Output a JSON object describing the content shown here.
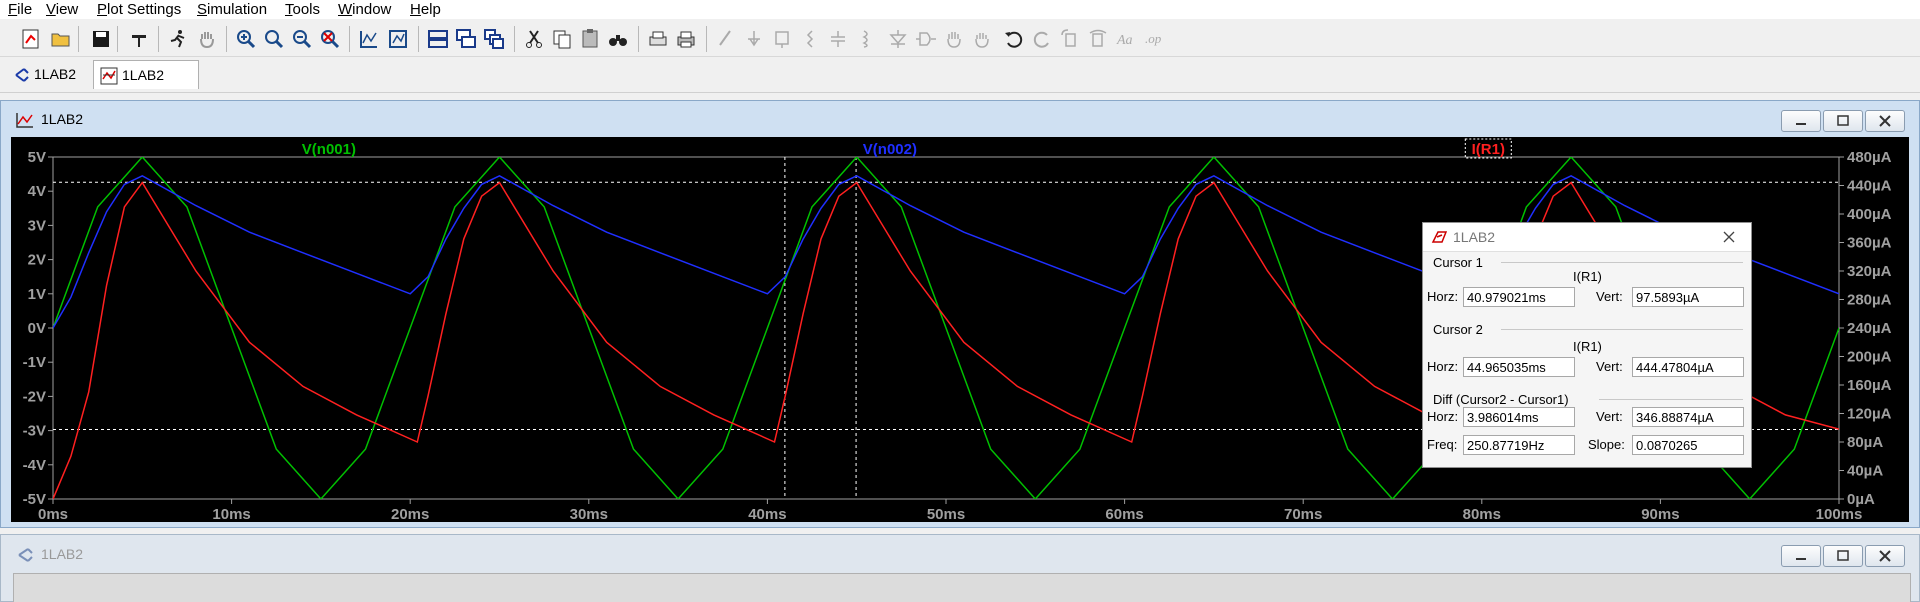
{
  "menu": [
    {
      "label": "File",
      "key": "F"
    },
    {
      "label": "View",
      "key": "V"
    },
    {
      "label": "Plot Settings",
      "key": "P"
    },
    {
      "label": "Simulation",
      "key": "S"
    },
    {
      "label": "Tools",
      "key": "T"
    },
    {
      "label": "Window",
      "key": "W"
    },
    {
      "label": "Help",
      "key": "H"
    }
  ],
  "tabs": [
    {
      "label": "1LAB2",
      "icon": "schematic-icon"
    },
    {
      "label": "1LAB2",
      "icon": "waveform-icon"
    }
  ],
  "plot_window": {
    "title": "1LAB2",
    "icon": "waveform-icon"
  },
  "schematic_window": {
    "title": "1LAB2",
    "icon": "schematic-icon"
  },
  "cursor_window": {
    "title": "1LAB2",
    "cursor1": {
      "heading": "Cursor 1",
      "trace": "I(R1)",
      "horz_label": "Horz:",
      "horz": "40.979021ms",
      "vert_label": "Vert:",
      "vert": "97.5893µA"
    },
    "cursor2": {
      "heading": "Cursor 2",
      "trace": "I(R1)",
      "horz_label": "Horz:",
      "horz": "44.965035ms",
      "vert_label": "Vert:",
      "vert": "444.47804µA"
    },
    "diff": {
      "heading": "Diff (Cursor2 - Cursor1)",
      "horz_label": "Horz:",
      "horz": "3.986014ms",
      "vert_label": "Vert:",
      "vert": "346.88874µA",
      "freq_label": "Freq:",
      "freq": "250.87719Hz",
      "slope_label": "Slope:",
      "slope": "0.0870265"
    }
  },
  "chart_data": {
    "type": "line",
    "title": "",
    "xlabel": "",
    "ylabel": "",
    "xlim": [
      0,
      100
    ],
    "x_ticks": [
      "0ms",
      "10ms",
      "20ms",
      "30ms",
      "40ms",
      "50ms",
      "60ms",
      "70ms",
      "80ms",
      "90ms",
      "100ms"
    ],
    "ylim_left": [
      -5,
      5
    ],
    "y_ticks_left": [
      "5V",
      "4V",
      "3V",
      "2V",
      "1V",
      "0V",
      "-1V",
      "-2V",
      "-3V",
      "-4V",
      "-5V"
    ],
    "ylim_right": [
      0,
      480
    ],
    "y_ticks_right": [
      "480µA",
      "440µA",
      "400µA",
      "360µA",
      "320µA",
      "280µA",
      "240µA",
      "200µA",
      "160µA",
      "120µA",
      "80µA",
      "40µA",
      "0µA"
    ],
    "grid": false,
    "cursors": {
      "x": [
        40.979,
        44.965
      ],
      "y_right": [
        97.5893,
        444.478
      ]
    },
    "series": [
      {
        "name": "V(n001)",
        "color": "#00c000",
        "axis": "left",
        "x": [
          0,
          2.5,
          5,
          7.5,
          10,
          12.5,
          15,
          17.5,
          20,
          22.5,
          25,
          27.5,
          30,
          32.5,
          35,
          37.5,
          40,
          42.5,
          45,
          47.5,
          50,
          52.5,
          55,
          57.5,
          60,
          62.5,
          65,
          67.5,
          70,
          72.5,
          75,
          77.5,
          80,
          82.5,
          85,
          87.5,
          90,
          92.5,
          95,
          97.5,
          100
        ],
        "y": [
          0,
          3.54,
          5,
          3.54,
          0,
          -3.54,
          -5,
          -3.54,
          0,
          3.54,
          5,
          3.54,
          0,
          -3.54,
          -5,
          -3.54,
          0,
          3.54,
          5,
          3.54,
          0,
          -3.54,
          -5,
          -3.54,
          0,
          3.54,
          5,
          3.54,
          0,
          -3.54,
          -5,
          -3.54,
          0,
          3.54,
          5,
          3.54,
          0,
          -3.54,
          -5,
          -3.54,
          0
        ]
      },
      {
        "name": "V(n002)",
        "color": "#1f2fff",
        "axis": "left",
        "x": [
          0,
          1,
          2,
          3,
          4,
          5,
          8,
          11,
          14,
          17,
          20,
          21,
          22,
          23,
          24,
          25,
          28,
          31,
          34,
          37,
          40,
          41,
          42,
          43,
          44,
          45,
          48,
          51,
          54,
          57,
          60,
          61,
          62,
          63,
          64,
          65,
          68,
          71,
          74,
          77,
          80,
          81,
          82,
          83,
          84,
          85,
          88,
          91,
          94,
          97,
          100
        ],
        "y": [
          0,
          0.9,
          2.2,
          3.4,
          4.2,
          4.45,
          3.58,
          2.8,
          2.2,
          1.6,
          1.0,
          1.5,
          2.6,
          3.5,
          4.2,
          4.45,
          3.58,
          2.8,
          2.2,
          1.6,
          1.0,
          1.5,
          2.6,
          3.5,
          4.2,
          4.45,
          3.58,
          2.8,
          2.2,
          1.6,
          1.0,
          1.5,
          2.6,
          3.5,
          4.2,
          4.45,
          3.58,
          2.8,
          2.2,
          1.6,
          1.0,
          1.5,
          2.6,
          3.5,
          4.2,
          4.45,
          3.58,
          2.8,
          2.2,
          1.6,
          1.0
        ]
      },
      {
        "name": "I(R1)",
        "color": "#ff2020",
        "axis": "right",
        "x": [
          0,
          1,
          2,
          3,
          4,
          5,
          8,
          11,
          14,
          17,
          20.4,
          21,
          22,
          23,
          24,
          25,
          28,
          31,
          34,
          37,
          40.4,
          41,
          42,
          43,
          44,
          45,
          48,
          51,
          54,
          57,
          60.4,
          61,
          62,
          63,
          64,
          65,
          68,
          71,
          74,
          77,
          80.4,
          81,
          82,
          83,
          84,
          85,
          88,
          91,
          94,
          97,
          100
        ],
        "y": [
          0,
          60,
          150,
          300,
          410,
          444,
          320,
          220,
          158,
          118,
          80,
          145,
          260,
          365,
          425,
          444,
          320,
          220,
          158,
          118,
          80,
          145,
          260,
          365,
          425,
          444,
          320,
          220,
          158,
          118,
          80,
          145,
          260,
          365,
          425,
          444,
          320,
          220,
          158,
          118,
          80,
          145,
          260,
          365,
          425,
          444,
          320,
          220,
          158,
          118,
          98
        ]
      }
    ]
  }
}
